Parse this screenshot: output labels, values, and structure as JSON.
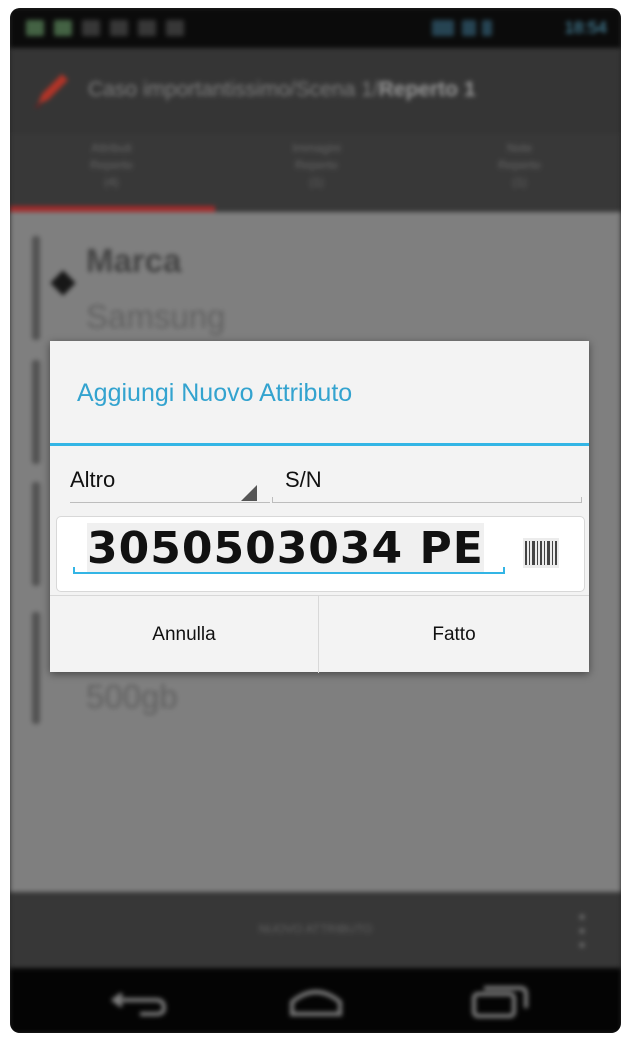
{
  "statusbar": {
    "time": "18:54"
  },
  "actionbar": {
    "path": "Caso importantissimo/Scena 1/",
    "title": "Reperto 1"
  },
  "tabs": [
    {
      "line1": "Attributi",
      "line2": "Reperto",
      "line3": "(4)"
    },
    {
      "line1": "Immagini",
      "line2": "Reperto",
      "line3": "(1)"
    },
    {
      "line1": "Note",
      "line2": "Reperto",
      "line3": "(1)"
    }
  ],
  "content": {
    "attr_name": "Marca",
    "attr_value": "Samsung",
    "attr_value_2": "500gb"
  },
  "bottom_action": {
    "label": "NUOVO ATTRIBUTO"
  },
  "dialog": {
    "title": "Aggiungi Nuovo Attributo",
    "type_selected": "Altro",
    "name_value": "S/N",
    "value": "3050503034 PE",
    "cancel_label": "Annulla",
    "done_label": "Fatto"
  },
  "colors": {
    "accent": "#33b5e5",
    "tab_indicator": "#b03030"
  },
  "icons": [
    "edit-pencil-icon",
    "tag-icon",
    "barcode-icon",
    "back-icon",
    "home-icon",
    "recents-icon",
    "overflow-menu-icon"
  ]
}
